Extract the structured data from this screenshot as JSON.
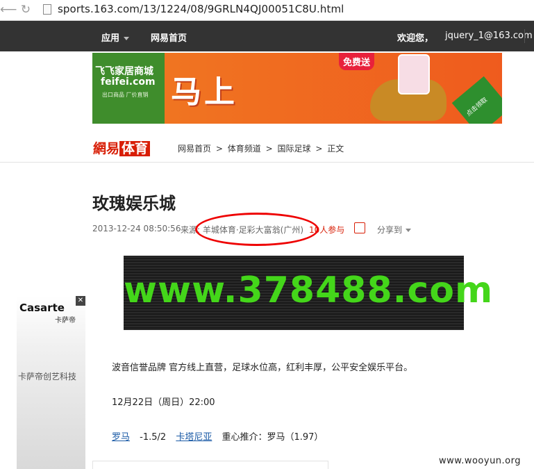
{
  "browser": {
    "url": "sports.163.com/13/1224/08/9GRLN4QJ00051C8U.html",
    "back_glyph": "⟵",
    "reload_glyph": "↻"
  },
  "topnav": {
    "apps_label": "应用",
    "home_label": "网易首页",
    "welcome": "欢迎您，",
    "user": "jquery_1@163.com"
  },
  "banner_ad": {
    "brand_line1": "飞飞家居商城",
    "brand_line2": "feifei.com",
    "brand_line3": "出口商品  厂价直销",
    "headline": "马上",
    "free_tag": "免费送",
    "badge": "点击领取"
  },
  "logo": {
    "part1": "網易",
    "part2": "体育"
  },
  "breadcrumb": [
    "网易首页",
    ">",
    "体育频道",
    ">",
    "国际足球",
    ">",
    "正文"
  ],
  "article": {
    "title": "玫瑰娱乐城",
    "date": "2013-12-24 08:50:56",
    "source": "来源: 羊城体育·足彩大富翁(广州)",
    "participants": "10人参与",
    "share": "分享到",
    "image_text": "www.378488.com",
    "para1": "波音信誉品牌 官方线上直营，足球水位高，红利丰厚，公平安全娱乐平台。",
    "para2": "12月22日（周日）22:00",
    "team_home": "罗马",
    "handicap": "-1.5/2",
    "team_away": "卡塔尼亚",
    "recommend": "重心推介：罗马（1.97）"
  },
  "side_ad": {
    "brand": "Casarte",
    "brand_cn": "卡萨帝",
    "slogan": "卡萨帝创艺科技",
    "close": "✕"
  },
  "watermark": "www.wooyun.org",
  "colors": {
    "nav_bg": "#333333",
    "brand_red": "#d81e06",
    "link_blue": "#1a5aa6",
    "image_green": "#44d61a"
  },
  "icons": [
    "back-arrow-icon",
    "reload-icon",
    "page-icon",
    "caret-down-icon",
    "edit-icon",
    "close-icon"
  ]
}
